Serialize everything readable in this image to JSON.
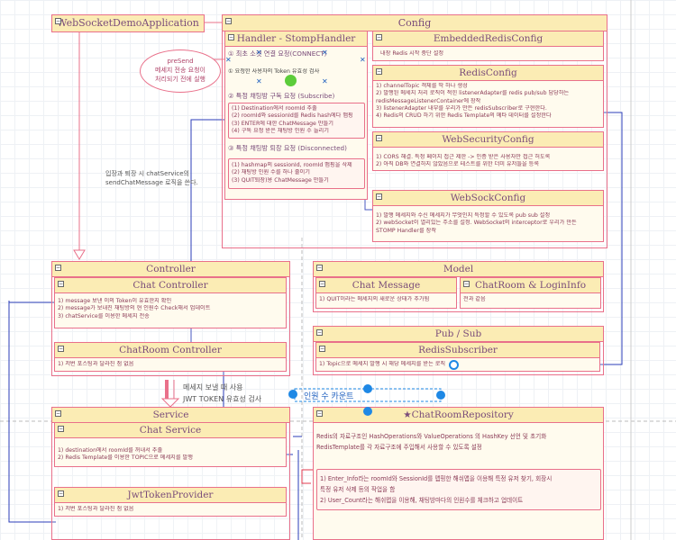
{
  "app": {
    "title": "WebSocketDemoApplication",
    "presend_note": [
      "preSend",
      "메세지 전송 요청이",
      "처리되기 전에 실행"
    ],
    "left_note": [
      "입장과 퇴장 시 chatService의",
      "sendChatMessage 로직을 쓴다."
    ]
  },
  "config": {
    "title": "Config",
    "handler": {
      "title": "Handler - StompHandler",
      "sec1_title": "① 최초 소켓 연결 요청(CONNECT)",
      "sec1_line": "① 요청한 사용자의 Token 유효성 검사",
      "sec2_title": "② 특정 채팅방 구독 요청 (Subscribe)",
      "sec2_lines": [
        "(1) Destination에서 roomId 추출",
        "(2) roomId와 sessionId를 Redis hash에다 맵핑",
        "(3) ENTER에 대한 ChatMessage 만들기",
        "(4) 구독 요청 받은 채팅방 인원 수 늘리기"
      ],
      "sec3_title": "③ 특정 채팅방 퇴장 요청 (Disconnected)",
      "sec3_lines": [
        "(1) hashmap의 sessionId, roomId 맵핑을 삭제",
        "(2) 채팅방 인원 수를 하나 줄이기",
        "(3) QUIT퇴장)용 ChatMessage 만들기"
      ]
    },
    "embedded": {
      "title": "EmbeddedRedisConfig",
      "lines": [
        "내장 Redis 시작 중단 설정"
      ]
    },
    "redis": {
      "title": "RedisConfig",
      "lines": [
        "1) channelTopic 객체를 딱 하나 생성",
        "2) 발행된 메세지 처리 로직이 적힌 listenerAdapter를 redis pub/sub 담당하는",
        "    redisMessageListenerContainer에 장착",
        "3) listenerAdapter 내부를 우리가 만든 redisSubscriber로 구현한다.",
        "4) Redis의 CRUD 하기 위한 Redis Template의 메타 데이터를 설정한다"
      ]
    },
    "security": {
      "title": "WebSecurityConfig",
      "lines": [
        "1) CORS 해결. 특정 페이지 접근 제한 -> 인증 받은 사용자만 접근 허도록",
        "2) 아직 DB와 연결하지 않았음으로 테스트를 위한 더미 유저들을 등록"
      ]
    },
    "websock": {
      "title": "WebSockConfig",
      "lines": [
        "1) 발행 메세지와 수신 메세지가 무엇인지 특정할 수 있도록 pub sub 설정",
        "2) webSocket이 열리있는 주소를 설정. WebSocket의 interceptor로 우리가 만든",
        "STOMP Handler를 장착"
      ]
    }
  },
  "controller": {
    "title": "Controller",
    "chat": {
      "title": "Chat Controller",
      "lines": [
        "1) message 보낸 이의 Token이 유효한지 확인",
        "2) message가 보내진 채팅방의 현 인원수 Check해서 업데이트",
        "3) chatService를 이용한 메세지 전송"
      ]
    },
    "room": {
      "title": "ChatRoom Controller",
      "lines": [
        "1) 저번 포스팅과 달라진 점 없음"
      ]
    }
  },
  "mid_note": [
    "메세지 보낼 때 사용",
    "JWT TOKEN 유효성 검사"
  ],
  "count_label": "인원 수 카운트",
  "service": {
    "title": "Service",
    "chat": {
      "title": "Chat Service",
      "lines": [
        "1) destination에서 roomId를 꺼내서 추출",
        "2) Redis Template를 이용한 TOPIC으로 메세지를 발행"
      ]
    },
    "jwt": {
      "title": "JwtTokenProvider",
      "lines": [
        "1) 저번 포스팅과 달라진 점 없음"
      ]
    }
  },
  "model": {
    "title": "Model",
    "message": {
      "title": "Chat Message",
      "lines": [
        "1) QUIT이라는 메세지의 새로운 상태가 추가됨"
      ]
    },
    "room": {
      "title": "ChatRoom & LoginInfo",
      "lines": [
        "전과 같음"
      ]
    }
  },
  "pubsub": {
    "title": "Pub / Sub",
    "subscriber": {
      "title": "RedisSubscriber",
      "lines": [
        "1) Topic으로 메세지 발행 시 해당 메세지를 받는 로직"
      ]
    }
  },
  "repository": {
    "title": "★ChatRoomRepository",
    "lines": [
      "Redis의 자료구조인 HashOperations와 ValueOperations 의 HashKey 선언 및 초기화",
      "RedisTemplate를 각 자료구조에 주입해서 사용할 수 있도록 설정"
    ],
    "sub_lines": [
      "1) Enter_Info라는 roomId와 SessionId를 맵핑한 해쉬맵을 이용해 특정 유저 찾기, 회장시",
      "특정 유저 삭제 등의 작업을 함",
      "2) User_Count라는 해쉬맵을 이용해, 채팅방마다의 인원수를 체크하고 업데이트"
    ]
  }
}
